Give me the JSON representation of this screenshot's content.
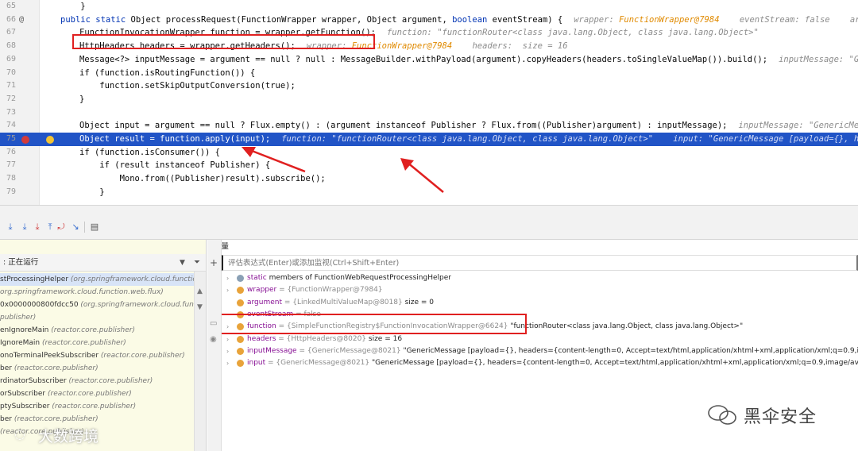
{
  "editor": {
    "lines": [
      {
        "num": "65",
        "code": "    }",
        "hint": ""
      },
      {
        "num": "66",
        "code_parts": [
          [
            "kw",
            "public static "
          ],
          [
            "",
            "Object processRequest(FunctionWrapper wrapper, Object argument, "
          ],
          [
            "kw",
            "boolean "
          ],
          [
            "",
            "eventStream) {"
          ]
        ],
        "hint_parts": [
          [
            "s",
            "wrapper: "
          ],
          [
            "o",
            "FunctionWrapper@7984"
          ],
          [
            "s",
            "    eventStream: false    argument:"
          ]
        ]
      },
      {
        "num": "67",
        "code": "FunctionInvocationWrapper function = wrapper.getFunction();",
        "hint": "function: \"functionRouter<class java.lang.Object, class java.lang.Object>\""
      },
      {
        "num": "68",
        "code": "HttpHeaders headers = wrapper.getHeaders();",
        "hint_parts": [
          [
            "s",
            "wrapper: "
          ],
          [
            "o",
            "FunctionWrapper@7984"
          ],
          [
            "s",
            "    headers:  size = 16"
          ]
        ]
      },
      {
        "num": "69",
        "code": "Message<?> inputMessage = argument == null ? null : MessageBuilder.withPayload(argument).copyHeaders(headers.toSingleValueMap()).build();",
        "hint": "inputMessage: \"GenericMessage"
      },
      {
        "num": "70",
        "code": "if (function.isRoutingFunction()) {",
        "hint": ""
      },
      {
        "num": "71",
        "code": "    function.setSkipOutputConversion(true);",
        "hint": ""
      },
      {
        "num": "72",
        "code": "}",
        "hint": ""
      },
      {
        "num": "73",
        "code": "",
        "hint": ""
      },
      {
        "num": "74",
        "code": "Object input = argument == null ? Flux.empty() : (argument instanceof Publisher ? Flux.from((Publisher)argument) : inputMessage);",
        "hint": "inputMessage: \"GenericMessage"
      },
      {
        "num": "75",
        "code": "Object result = function.apply(input);",
        "hint": "function: \"functionRouter<class java.lang.Object, class java.lang.Object>\"    input: \"GenericMessage [payload={}, headers"
      },
      {
        "num": "76",
        "code": "if (function.isConsumer()) {",
        "hint": ""
      },
      {
        "num": "77",
        "code": "    if (result instanceof Publisher) {",
        "hint": ""
      },
      {
        "num": "78",
        "code": "        Mono.from((Publisher)result).subscribe();",
        "hint": ""
      },
      {
        "num": "79",
        "code": "    }",
        "hint": ""
      }
    ]
  },
  "frames": {
    "status": ": 正在运行",
    "items": [
      {
        "name": "stProcessingHelper",
        "pkg": "(org.springframework.cloud.function.we"
      },
      {
        "name": "",
        "pkg": "org.springframework.cloud.function.web.flux)"
      },
      {
        "name": "0x0000000800fdcc50",
        "pkg": "(org.springframework.cloud.function."
      },
      {
        "name": "",
        "pkg": "publisher)"
      },
      {
        "name": "enIgnoreMain",
        "pkg": "(reactor.core.publisher)"
      },
      {
        "name": "IgnoreMain",
        "pkg": "(reactor.core.publisher)"
      },
      {
        "name": "onoTerminalPeekSubscriber",
        "pkg": "(reactor.core.publisher)"
      },
      {
        "name": "ber",
        "pkg": "(reactor.core.publisher)"
      },
      {
        "name": "rdinatorSubscriber",
        "pkg": "(reactor.core.publisher)"
      },
      {
        "name": "orSubscriber",
        "pkg": "(reactor.core.publisher)"
      },
      {
        "name": "ptySubscriber",
        "pkg": "(reactor.core.publisher)"
      },
      {
        "name": "ber",
        "pkg": "(reactor.core.publisher)"
      },
      {
        "name": "",
        "pkg": "(reactor.core.publisher)"
      }
    ]
  },
  "variables": {
    "title": "变量",
    "eval_placeholder": "评估表达式(Enter)或添加监视(Ctrl+Shift+Enter)",
    "rows": [
      {
        "name": "static",
        "type": "",
        "value": "members of FunctionWebRequestProcessingHelper",
        "icon": "#8aa0b5",
        "expand": "›"
      },
      {
        "name": "wrapper",
        "type": "= {FunctionWrapper@7984}",
        "value": "",
        "icon": "#e8a33a",
        "expand": "›"
      },
      {
        "name": "argument",
        "type": "= {LinkedMultiValueMap@8018}",
        "value": " size = 0",
        "icon": "#e8a33a",
        "expand": ""
      },
      {
        "name": "eventStream",
        "type": "= false",
        "value": "",
        "icon": "#e8a33a",
        "expand": ""
      },
      {
        "name": "function",
        "type": "= {SimpleFunctionRegistry$FunctionInvocationWrapper@6624}",
        "value": " \"functionRouter<class java.lang.Object, class java.lang.Object>\"",
        "icon": "#e8a33a",
        "expand": "›"
      },
      {
        "name": "headers",
        "type": "= {HttpHeaders@8020}",
        "value": " size = 16",
        "icon": "#e8a33a",
        "expand": "›"
      },
      {
        "name": "inputMessage",
        "type": "= {GenericMessage@8021}",
        "value": " \"GenericMessage [payload={}, headers={content-length=0, Accept=text/html,application/xhtml+xml,application/xml;q=0.9,image/av",
        "icon": "#e8a33a",
        "expand": "›"
      },
      {
        "name": "input",
        "type": "= {GenericMessage@8021}",
        "value": " \"GenericMessage [payload={}, headers={content-length=0, Accept=text/html,application/xhtml+xml,application/xml;q=0.9,image/avif,image/w",
        "icon": "#e8a33a",
        "expand": "›"
      }
    ]
  },
  "watermarks": {
    "right": "黑伞安全",
    "left": "大数跨境"
  },
  "colors": {
    "highlight": "#2154c6",
    "annotation_red": "#e02020",
    "frames_bg": "#fbfbe6"
  }
}
